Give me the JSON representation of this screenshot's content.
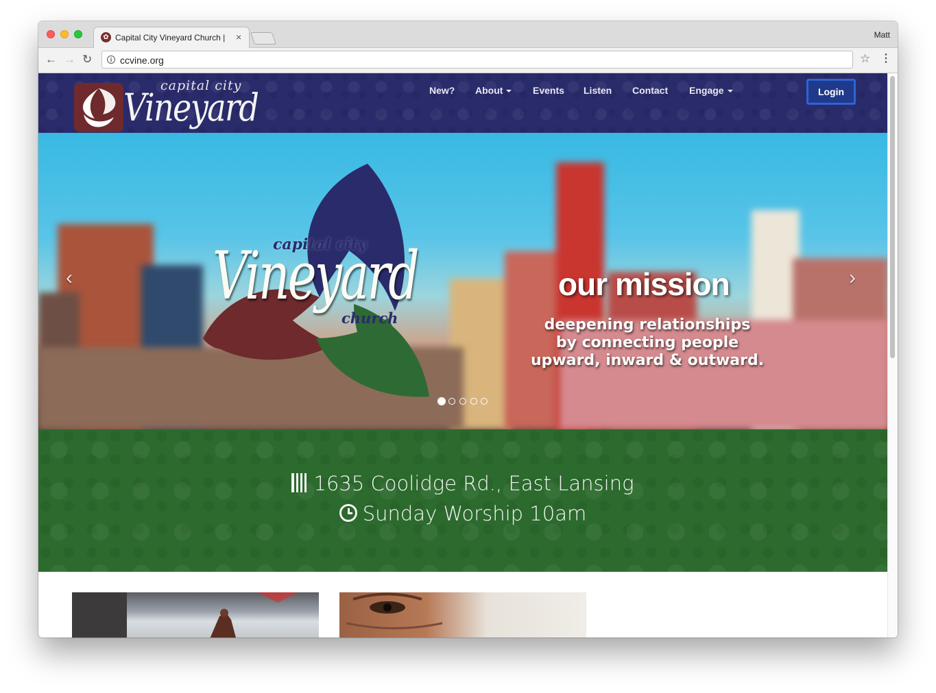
{
  "browser": {
    "tab_title": "Capital City Vineyard Church |",
    "tab_close": "×",
    "profile_name": "Matt",
    "url": "ccvine.org",
    "buttons": {
      "back": "←",
      "forward": "→",
      "reload": "↻",
      "bookmark": "☆",
      "menu": "⋮",
      "info": "i"
    }
  },
  "site": {
    "logo": {
      "small": "capital city",
      "big": "Vineyard"
    },
    "nav": [
      {
        "label": "New?",
        "dropdown": false
      },
      {
        "label": "About",
        "dropdown": true
      },
      {
        "label": "Events",
        "dropdown": false
      },
      {
        "label": "Listen",
        "dropdown": false
      },
      {
        "label": "Contact",
        "dropdown": false
      },
      {
        "label": "Engage",
        "dropdown": true
      }
    ],
    "login_label": "Login",
    "colors": {
      "header": "#2a2b6b",
      "band": "#2c6a2e",
      "login": "#1f3a8a",
      "maroon": "#6e2a2c"
    }
  },
  "hero": {
    "logo_capital": "capital city",
    "logo_vineyard": "Vineyard",
    "logo_church": "church",
    "title": "our mission",
    "lines": [
      "deepening relationships",
      "by connecting people",
      "upward, inward & outward."
    ],
    "prev_arrow": "‹",
    "next_arrow": "›",
    "slide_count": 5,
    "active_slide": 1
  },
  "info": {
    "address": "1635 Coolidge Rd., East Lansing",
    "worship": "Sunday Worship 10am"
  }
}
